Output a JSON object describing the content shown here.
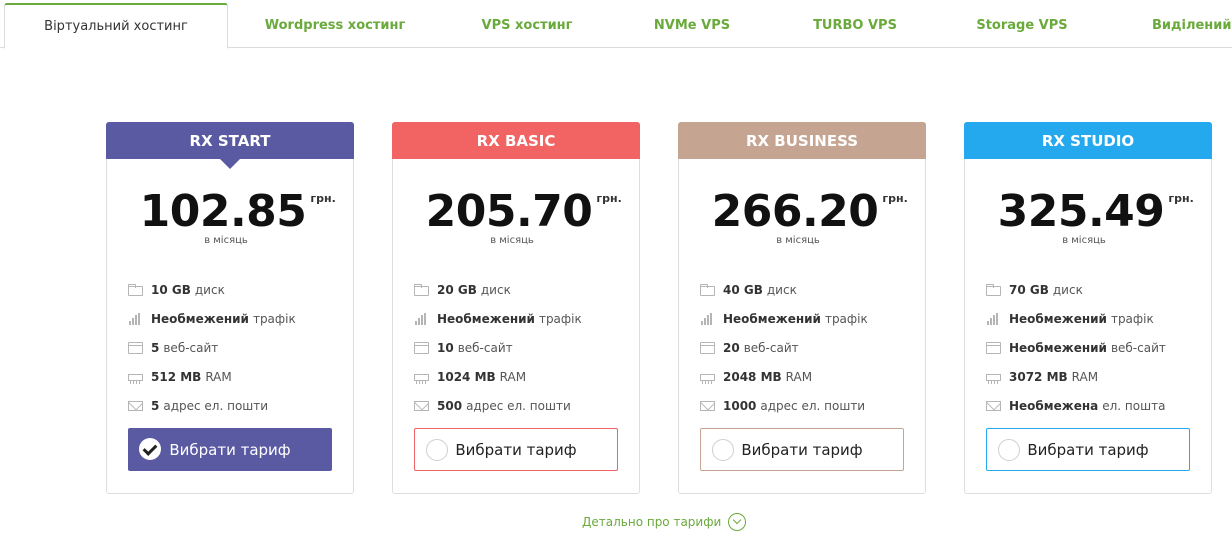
{
  "tabs": [
    {
      "label": "Віртуальний хостинг",
      "active": true
    },
    {
      "label": "Wordpress хостинг"
    },
    {
      "label": "VPS хостинг"
    },
    {
      "label": "NVMe VPS"
    },
    {
      "label": "TURBO VPS"
    },
    {
      "label": "Storage VPS"
    },
    {
      "label": "Виділений се"
    }
  ],
  "currency": "грн.",
  "per_month": "в місяць",
  "choose_label": "Вибрати тариф",
  "details_label": "Детально про тарифи",
  "colors": {
    "accent_green": "#6aaa3c",
    "start": "#5a5aa3",
    "basic": "#f26363",
    "business": "#c5a591",
    "studio": "#25a9ee"
  },
  "plans": [
    {
      "name": "RX START",
      "price": "102.85",
      "selected": true,
      "features": [
        {
          "icon": "folder-icon",
          "bold": "10 GB",
          "text": "диск"
        },
        {
          "icon": "traffic-icon",
          "bold": "Необмежений",
          "text": "трафік"
        },
        {
          "icon": "website-icon",
          "bold": "5",
          "text": "веб-сайт"
        },
        {
          "icon": "ram-icon",
          "bold": "512 MB",
          "text": "RAM"
        },
        {
          "icon": "mail-icon",
          "bold": "5",
          "text": "адрес ел. пошти"
        }
      ]
    },
    {
      "name": "RX BASIC",
      "price": "205.70",
      "selected": false,
      "features": [
        {
          "icon": "folder-icon",
          "bold": "20 GB",
          "text": "диск"
        },
        {
          "icon": "traffic-icon",
          "bold": "Необмежений",
          "text": "трафік"
        },
        {
          "icon": "website-icon",
          "bold": "10",
          "text": "веб-сайт"
        },
        {
          "icon": "ram-icon",
          "bold": "1024 MB",
          "text": "RAM"
        },
        {
          "icon": "mail-icon",
          "bold": "500",
          "text": "адрес ел. пошти"
        }
      ]
    },
    {
      "name": "RX BUSINESS",
      "price": "266.20",
      "selected": false,
      "features": [
        {
          "icon": "folder-icon",
          "bold": "40 GB",
          "text": "диск"
        },
        {
          "icon": "traffic-icon",
          "bold": "Необмежений",
          "text": "трафік"
        },
        {
          "icon": "website-icon",
          "bold": "20",
          "text": "веб-сайт"
        },
        {
          "icon": "ram-icon",
          "bold": "2048 MB",
          "text": "RAM"
        },
        {
          "icon": "mail-icon",
          "bold": "1000",
          "text": "адрес ел. пошти"
        }
      ]
    },
    {
      "name": "RX STUDIO",
      "price": "325.49",
      "selected": false,
      "features": [
        {
          "icon": "folder-icon",
          "bold": "70 GB",
          "text": "диск"
        },
        {
          "icon": "traffic-icon",
          "bold": "Необмежений",
          "text": "трафік"
        },
        {
          "icon": "website-icon",
          "bold": "Необмежений",
          "text": "веб-сайт"
        },
        {
          "icon": "ram-icon",
          "bold": "3072 MB",
          "text": "RAM"
        },
        {
          "icon": "mail-icon",
          "bold": "Необмежена",
          "text": "ел. пошта"
        }
      ]
    }
  ]
}
